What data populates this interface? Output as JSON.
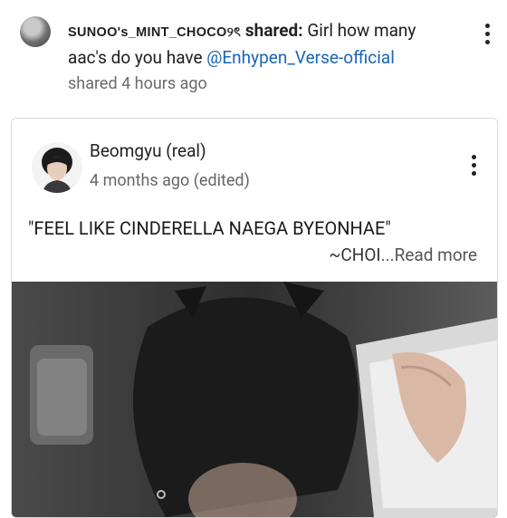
{
  "share": {
    "username": "SUNOO's_MINT_CHOCO୨ৎ",
    "shared_label": "shared:",
    "message_prefix": "Girl how many aac's do you have",
    "mention": "@Enhypen_Verse-official",
    "time": "shared 4 hours ago"
  },
  "post": {
    "author": "Beomgyu (real)",
    "time": "4 months ago (edited)",
    "text_line1": "\"FEEL LIKE CINDERELLA NAEGA BYEONHAE\"",
    "text_line2": "~CHOI",
    "read_more": "...Read more"
  },
  "icons": {
    "share_menu": "more-vert-icon",
    "post_menu": "more-vert-icon",
    "avatar_small": "profile-photo",
    "avatar_large": "profile-photo"
  },
  "colors": {
    "mention": "#1a66b3",
    "card_border": "#dadada",
    "secondary_text": "#6a6a6a"
  }
}
